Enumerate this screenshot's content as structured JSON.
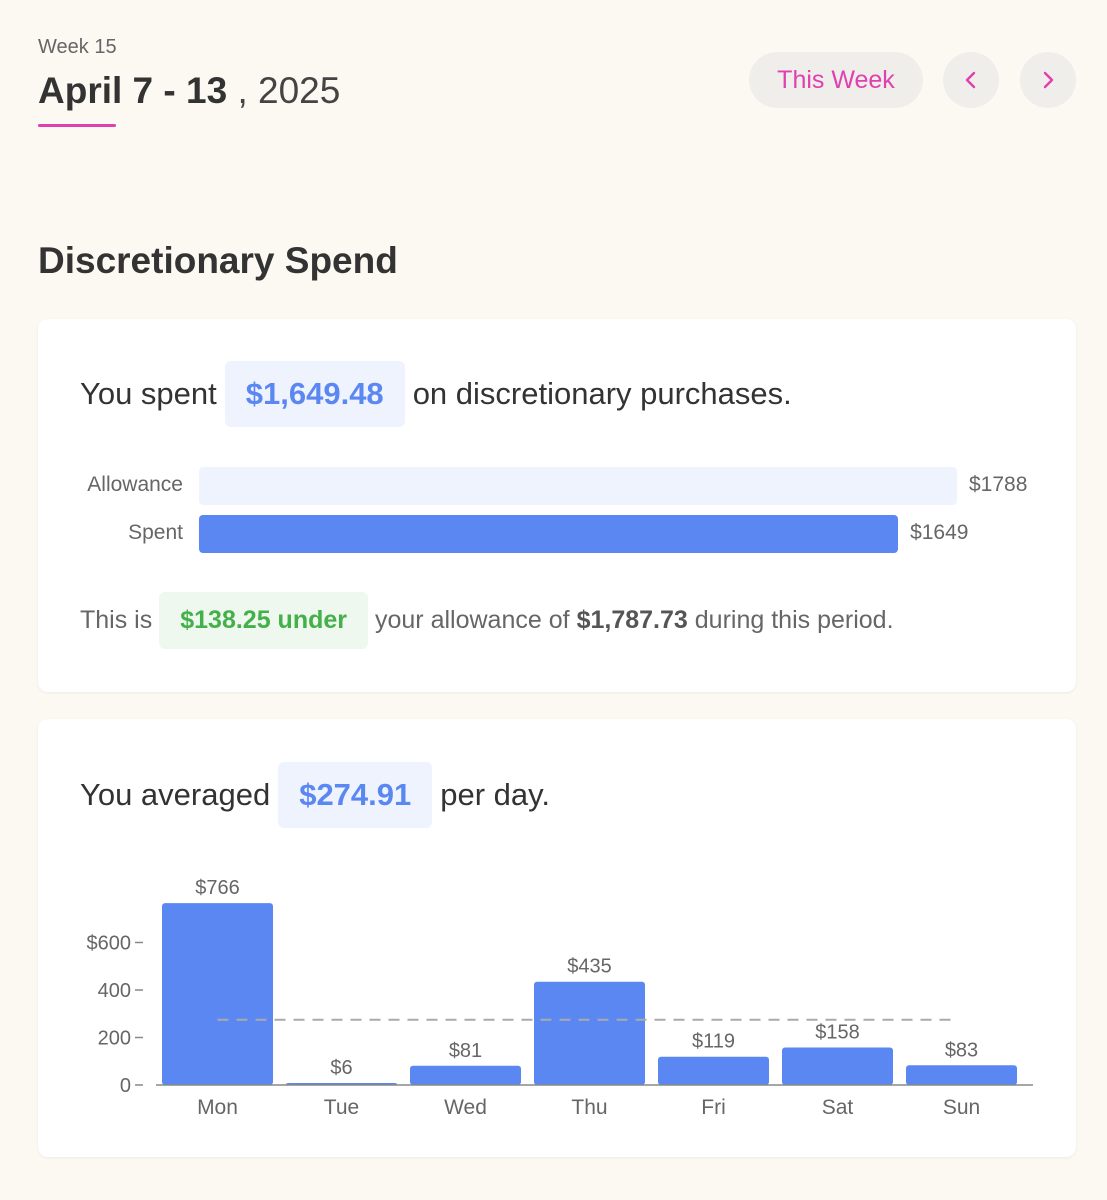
{
  "header": {
    "week_label": "Week 15",
    "date_range": "April 7 - 13",
    "year_suffix": ", 2025",
    "this_week_label": "This Week",
    "prev_icon": "chevron-left-icon",
    "next_icon": "chevron-right-icon"
  },
  "section": {
    "title": "Discretionary Spend"
  },
  "summary": {
    "spent_prefix": "You spent",
    "spent_amount": "$1,649.48",
    "spent_suffix": "on discretionary purchases.",
    "allowance_label": "Allowance",
    "allowance_value": "$1788",
    "spent_label": "Spent",
    "spent_value": "$1649",
    "allowance_number": 1788,
    "spent_number": 1649,
    "under_prefix": "This is",
    "under_amount": "$138.25 under",
    "under_middle": "your allowance of",
    "allowance_full": "$1,787.73",
    "under_suffix": "during this period."
  },
  "daily": {
    "avg_prefix": "You averaged",
    "avg_amount": "$274.91",
    "avg_suffix": "per day."
  },
  "colors": {
    "accent": "#e040b0",
    "bar": "#5b87f2",
    "allowance_track": "#eef3fd",
    "green": "#44b04a"
  },
  "chart_data": {
    "type": "bar",
    "categories": [
      "Mon",
      "Tue",
      "Wed",
      "Thu",
      "Fri",
      "Sat",
      "Sun"
    ],
    "values": [
      766,
      6,
      81,
      435,
      119,
      158,
      83
    ],
    "data_labels": [
      "$766",
      "$6",
      "$81",
      "$435",
      "$119",
      "$158",
      "$83"
    ],
    "y_ticks": [
      0,
      200,
      400,
      600
    ],
    "y_tick_labels": [
      "0",
      "200",
      "400",
      "600"
    ],
    "y_tick_prefix": "$",
    "average_line": 274.91,
    "ylim": [
      0,
      800
    ],
    "grid": false
  }
}
